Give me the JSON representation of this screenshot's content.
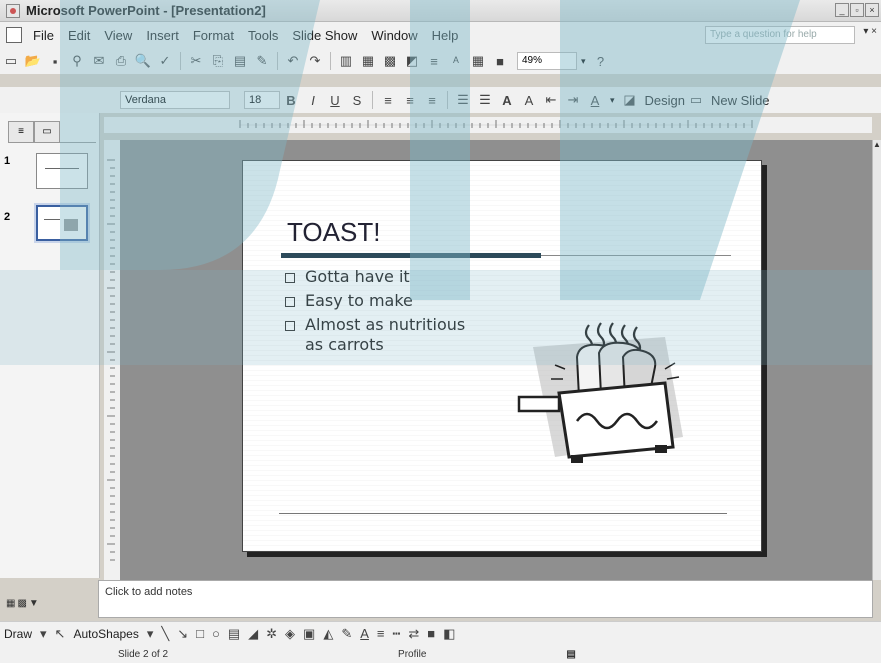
{
  "window": {
    "title": "Microsoft PowerPoint - [Presentation2]"
  },
  "menubar": {
    "items": [
      "File",
      "Edit",
      "View",
      "Insert",
      "Format",
      "Tools",
      "Slide Show",
      "Window",
      "Help"
    ],
    "ask_placeholder": "Type a question for help"
  },
  "standard_toolbar": {
    "zoom": "49%"
  },
  "formatting_toolbar": {
    "font": "Verdana",
    "font_size": "18",
    "design_label": "Design",
    "new_slide_label": "New Slide"
  },
  "slides_panel": {
    "slide_numbers": [
      "1",
      "2"
    ],
    "selected_index": 2
  },
  "slide": {
    "title": "TOAST!",
    "bullets": [
      "Gotta have it",
      "Easy to make",
      "Almost as nutritious as carrots"
    ]
  },
  "notes": {
    "placeholder": "Click to add notes"
  },
  "drawing_toolbar": {
    "draw_label": "Draw",
    "autoshapes_label": "AutoShapes"
  },
  "statusbar": {
    "slide_info": "Slide 2 of 2",
    "design": "Profile"
  }
}
